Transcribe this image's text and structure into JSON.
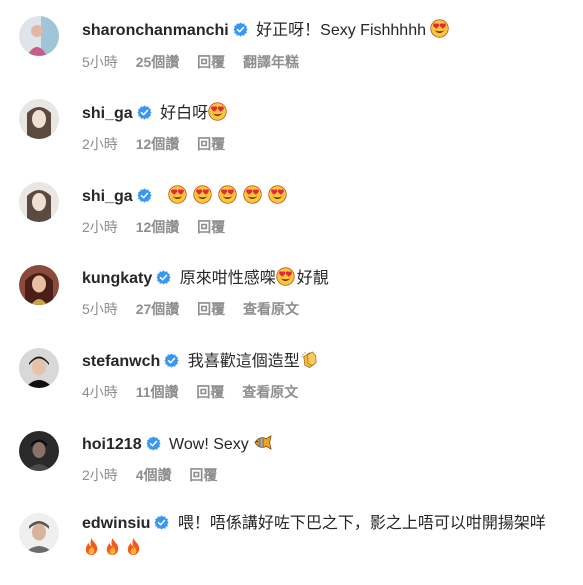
{
  "comments": [
    {
      "username": "sharonchanmanchi",
      "text": "好正呀！Sexy Fishhhhh",
      "emojis": [
        "heart-eyes"
      ],
      "time": "5小時",
      "likes": "25個讚",
      "reply": "回覆",
      "extra": "翻譯年糕"
    },
    {
      "username": "shi_ga",
      "text": "好白呀",
      "emojis": [
        "heart-eyes"
      ],
      "time": "2小時",
      "likes": "12個讚",
      "reply": "回覆",
      "extra": ""
    },
    {
      "username": "shi_ga",
      "text": "",
      "emojis": [
        "heart-eyes",
        "heart-eyes",
        "heart-eyes",
        "heart-eyes",
        "heart-eyes"
      ],
      "time": "2小時",
      "likes": "12個讚",
      "reply": "回覆",
      "extra": ""
    },
    {
      "username": "kungkaty",
      "text": "原來咁性感㗎",
      "text_after": "好靚",
      "emojis": [
        "heart-eyes"
      ],
      "time": "5小時",
      "likes": "27個讚",
      "reply": "回覆",
      "extra": "查看原文"
    },
    {
      "username": "stefanwch",
      "text": "我喜歡這個造型",
      "emojis": [
        "clapping-hands"
      ],
      "time": "4小時",
      "likes": "11個讚",
      "reply": "回覆",
      "extra": "查看原文"
    },
    {
      "username": "hoi1218",
      "text": "Wow! Sexy",
      "emojis": [
        "tropical-fish"
      ],
      "time": "2小時",
      "likes": "4個讚",
      "reply": "回覆",
      "extra": ""
    },
    {
      "username": "edwinsiu",
      "text": "喂！唔係講好咗下巴之下，影之上唔可以咁開揚架咩",
      "emojis": [
        "fire",
        "fire",
        "fire"
      ],
      "time": "",
      "likes": "",
      "reply": "",
      "extra": ""
    }
  ],
  "colors": {
    "text": "#262626",
    "meta": "#8e8e8e",
    "verified": "#3897f0"
  }
}
